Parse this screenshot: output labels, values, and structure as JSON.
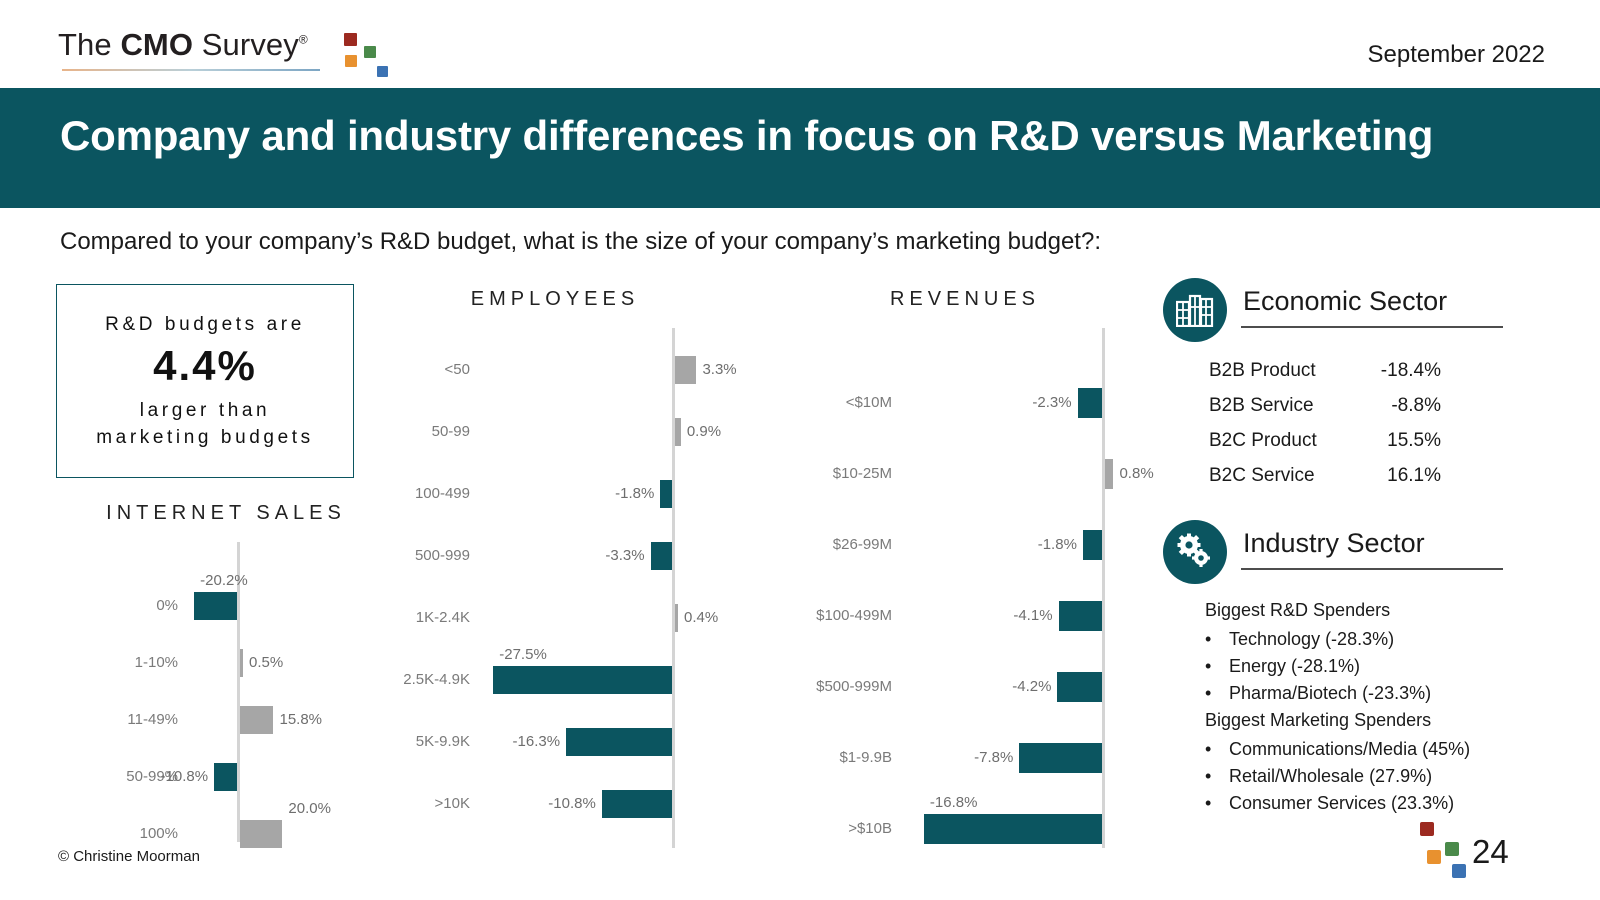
{
  "header": {
    "logo_the": "The ",
    "logo_cmo": "CMO",
    "logo_survey": " Survey",
    "logo_reg": "®",
    "date": "September 2022"
  },
  "title": "Company and industry differences in focus on R&D versus Marketing",
  "question": "Compared to your company’s R&D budget, what is the size of your company’s marketing budget?:",
  "callout": {
    "line1": "R&D budgets are",
    "big": "4.4%",
    "line2": "larger than",
    "line3": "marketing budgets"
  },
  "colors": {
    "brand_teal": "#0b5560",
    "bar_negative": "#0b5560",
    "bar_positive": "#a6a6a6",
    "axis": "#d4d4d4",
    "band": "#0b5560",
    "logo_red": "#9c2a20",
    "logo_green": "#4a8a4a",
    "logo_orange": "#e8912f",
    "logo_blue": "#3b72b3"
  },
  "chart_data": [
    {
      "type": "bar",
      "orientation": "horizontal-diverging",
      "title": "INTERNET SALES",
      "xlabel": "",
      "ylabel": "",
      "categories": [
        "0%",
        "1-10%",
        "11-49%",
        "50-99%",
        "100%"
      ],
      "values": [
        -20.2,
        0.5,
        15.8,
        -10.8,
        20.0
      ],
      "labels": [
        "-20.2%",
        "0.5%",
        "15.8%",
        "-10.8%",
        "20.0%"
      ],
      "xlim": [
        -30,
        30
      ],
      "grid": false,
      "legend": "none"
    },
    {
      "type": "bar",
      "orientation": "horizontal-diverging",
      "title": "EMPLOYEES",
      "xlabel": "",
      "ylabel": "",
      "categories": [
        "<50",
        "50-99",
        "100-499",
        "500-999",
        "1K-2.4K",
        "2.5K-4.9K",
        "5K-9.9K",
        ">10K"
      ],
      "values": [
        3.3,
        0.9,
        -1.8,
        -3.3,
        0.4,
        -27.5,
        -16.3,
        -10.8
      ],
      "labels": [
        "3.3%",
        "0.9%",
        "-1.8%",
        "-3.3%",
        "0.4%",
        "-27.5%",
        "-16.3%",
        "-10.8%"
      ],
      "xlim": [
        -30,
        10
      ],
      "grid": false,
      "legend": "none"
    },
    {
      "type": "bar",
      "orientation": "horizontal-diverging",
      "title": "REVENUES",
      "xlabel": "",
      "ylabel": "",
      "categories": [
        "<$10M",
        "$10-25M",
        "$26-99M",
        "$100-499M",
        "$500-999M",
        "$1-9.9B",
        ">$10B"
      ],
      "values": [
        -2.3,
        0.8,
        -1.8,
        -4.1,
        -4.2,
        -7.8,
        -16.8
      ],
      "labels": [
        "-2.3%",
        "0.8%",
        "-1.8%",
        "-4.1%",
        "-4.2%",
        "-7.8%",
        "-16.8%"
      ],
      "xlim": [
        -20,
        10
      ],
      "grid": false,
      "legend": "none"
    }
  ],
  "economic_sector": {
    "heading": "Economic Sector",
    "icon": "building-icon",
    "rows": [
      {
        "name": "B2B Product",
        "value": "-18.4%"
      },
      {
        "name": "B2B Service",
        "value": "-8.8%"
      },
      {
        "name": "B2C Product",
        "value": "15.5%"
      },
      {
        "name": "B2C Service",
        "value": "16.1%"
      }
    ]
  },
  "industry_sector": {
    "heading": "Industry Sector",
    "icon": "gears-icon",
    "group1_heading": "Biggest R&D Spenders",
    "group1": [
      "Technology (-28.3%)",
      "Energy (-28.1%)",
      "Pharma/Biotech (-23.3%)"
    ],
    "group2_heading": "Biggest Marketing Spenders",
    "group2": [
      "Communications/Media (45%)",
      "Retail/Wholesale (27.9%)",
      "Consumer Services (23.3%)"
    ],
    "bullet": "•"
  },
  "footer": {
    "copyright": "© Christine Moorman",
    "page": "24"
  }
}
